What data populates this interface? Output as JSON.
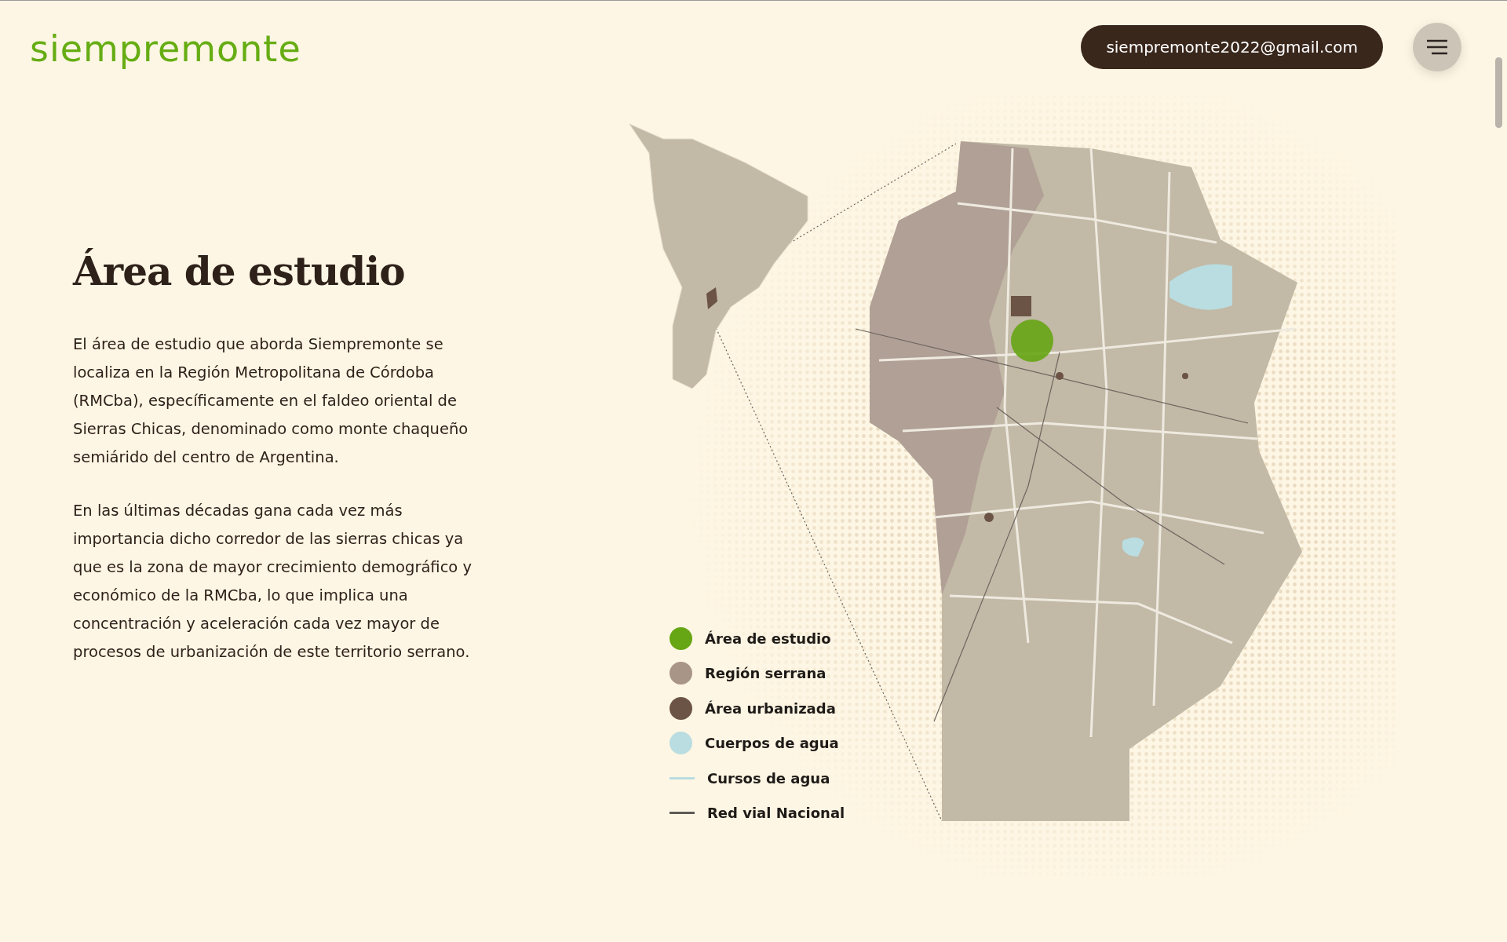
{
  "header": {
    "logo": "siempremonte",
    "email": "siempremonte2022@gmail.com"
  },
  "section": {
    "title": "Área de estudio",
    "paragraphs": [
      "El área de estudio que aborda Siempremonte se localiza en la Región Metropolitana de Córdoba (RMCba), específicamente en el faldeo oriental de Sierras Chicas, denominado como monte chaqueño semiárido del centro de Argentina.",
      "En las últimas décadas gana cada vez más importancia dicho corredor de las sierras chicas ya que es la zona de mayor crecimiento demográfico y económico de la RMCba, lo que implica una concentración y aceleración cada vez mayor de procesos de urbanización de este territorio serrano."
    ]
  },
  "legend": [
    {
      "label": "Área de estudio",
      "kind": "dot",
      "color": "#66a514"
    },
    {
      "label": "Región serrana",
      "kind": "dot",
      "color": "#a89587"
    },
    {
      "label": "Área urbanizada",
      "kind": "dot",
      "color": "#6b5446"
    },
    {
      "label": "Cuerpos de agua",
      "kind": "dot",
      "color": "#b9dde0"
    },
    {
      "label": "Cursos de agua",
      "kind": "line",
      "color": "#b9dde0"
    },
    {
      "label": "Red vial Nacional",
      "kind": "line",
      "color": "#5e5a57"
    }
  ]
}
